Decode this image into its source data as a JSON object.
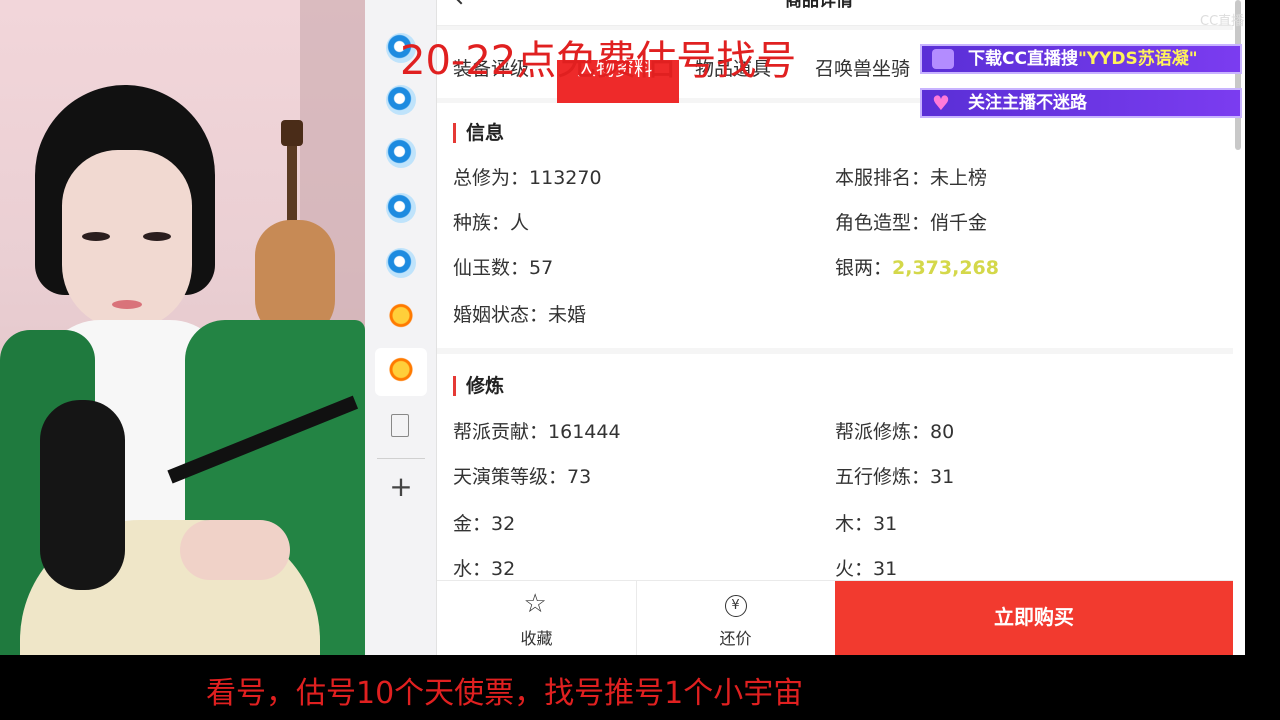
{
  "overlay": {
    "red_banner": "20-22点免费估号找号",
    "promo_download": "下载CC直播搜",
    "promo_keyword": "\"YYDS苏语凝\"",
    "promo_follow": "关注主播不迷路",
    "bottom_notice": "看号，估号10个天使票，找号推号1个小宇宙",
    "cc_logo": "CC直播"
  },
  "header": {
    "title": "商品详情"
  },
  "tabs": [
    "装备评级",
    "人物资料",
    "物品道具",
    "召唤兽坐骑"
  ],
  "info": {
    "title": "信息",
    "fields": [
      {
        "label": "总修为：",
        "value": "113270"
      },
      {
        "label": "本服排名：",
        "value": "未上榜"
      },
      {
        "label": "种族：",
        "value": "人"
      },
      {
        "label": "角色造型：",
        "value": "俏千金"
      },
      {
        "label": "仙玉数：",
        "value": "57"
      },
      {
        "label": "银两：",
        "value": "2,373,268"
      },
      {
        "label": "婚姻状态：",
        "value": "未婚"
      }
    ]
  },
  "cultivation": {
    "title": "修炼",
    "fields": [
      {
        "label": "帮派贡献：",
        "value": "161444"
      },
      {
        "label": "帮派修炼：",
        "value": "80"
      },
      {
        "label": "天演策等级：",
        "value": "73"
      },
      {
        "label": "五行修炼：",
        "value": "31"
      },
      {
        "label": "金：",
        "value": "32"
      },
      {
        "label": "木：",
        "value": "31"
      },
      {
        "label": "水：",
        "value": "32"
      },
      {
        "label": "火：",
        "value": "31"
      }
    ]
  },
  "actions": {
    "favorite": "收藏",
    "bargain": "还价",
    "buy": "立即购买",
    "yen_symbol": "¥",
    "star_symbol": "☆"
  },
  "sidebar": {
    "plus_symbol": "+"
  },
  "colors": {
    "accent_red": "#f23a2f",
    "silver_gold": "#d4d84a",
    "banner_purple": "#6a35e3"
  }
}
